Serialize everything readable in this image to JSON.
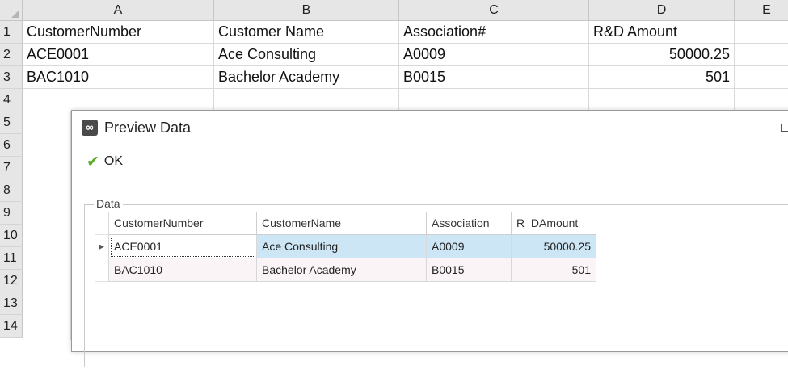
{
  "sheet": {
    "columns": [
      "A",
      "B",
      "C",
      "D",
      "E"
    ],
    "rows": [
      "1",
      "2",
      "3",
      "4",
      "5",
      "6",
      "7",
      "8",
      "9",
      "10",
      "11",
      "12",
      "13",
      "14"
    ],
    "cells": [
      [
        "CustomerNumber",
        "Customer Name",
        "Association#",
        "R&D Amount"
      ],
      [
        "ACE0001",
        "Ace Consulting",
        "A0009",
        "50000.25"
      ],
      [
        "BAC1010",
        "Bachelor Academy",
        "B0015",
        "501"
      ]
    ]
  },
  "dialog": {
    "title": "Preview Data",
    "app_icon": "link-icon",
    "ok_label": "OK",
    "ok_icon": "checkmark-icon",
    "group_label": "Data",
    "grid": {
      "headers": [
        "CustomerNumber",
        "CustomerName",
        "Association_",
        "R_DAmount"
      ],
      "rows": [
        [
          "ACE0001",
          "Ace Consulting",
          "A0009",
          "50000.25"
        ],
        [
          "BAC1010",
          "Bachelor Academy",
          "B0015",
          "501"
        ]
      ]
    }
  },
  "colors": {
    "selected_row": "#cde6f5",
    "ok_check": "#5aac2e",
    "header_bg": "#e6e6e6"
  }
}
